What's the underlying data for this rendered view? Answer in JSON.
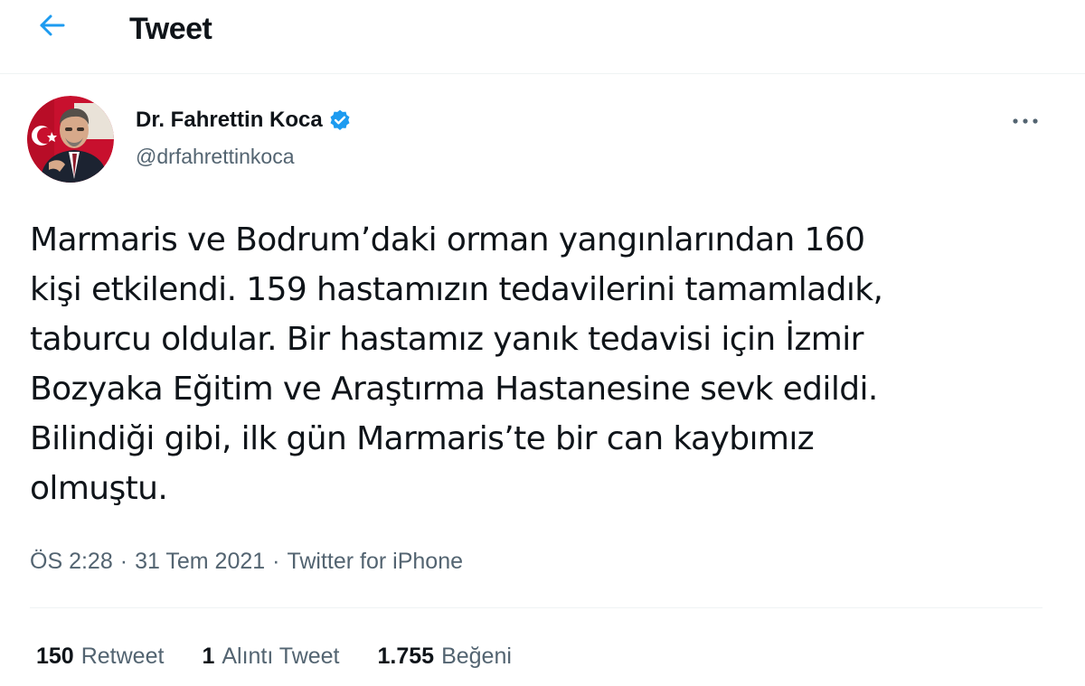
{
  "header": {
    "title": "Tweet",
    "back_icon": "arrow-left-icon",
    "accent_color": "#1d9bf0"
  },
  "tweet": {
    "author": {
      "name": "Dr. Fahrettin Koca",
      "handle": "@drfahrettinkoca",
      "verified": true,
      "verified_color": "#1d9bf0"
    },
    "text": "Marmaris ve Bodrum’daki orman yangınlarından 160\nkişi etkilendi. 159 hastamızın tedavilerini tamamladık,\ntaburcu oldular. Bir hastamız yanık tedavisi için İzmir\nBozyaka Eğitim ve Araştırma Hastanesine sevk edildi.\nBilindiği gibi, ilk gün Marmaris’te bir can kaybımız\nolmuştu.",
    "time": "ÖS 2:28",
    "date": "31 Tem 2021",
    "separator": "·",
    "source": "Twitter for iPhone",
    "stats": {
      "retweets": {
        "count": "150",
        "label": "Retweet"
      },
      "quotes": {
        "count": "1",
        "label": "Alıntı Tweet"
      },
      "likes": {
        "count": "1.755",
        "label": "Beğeni"
      }
    }
  }
}
